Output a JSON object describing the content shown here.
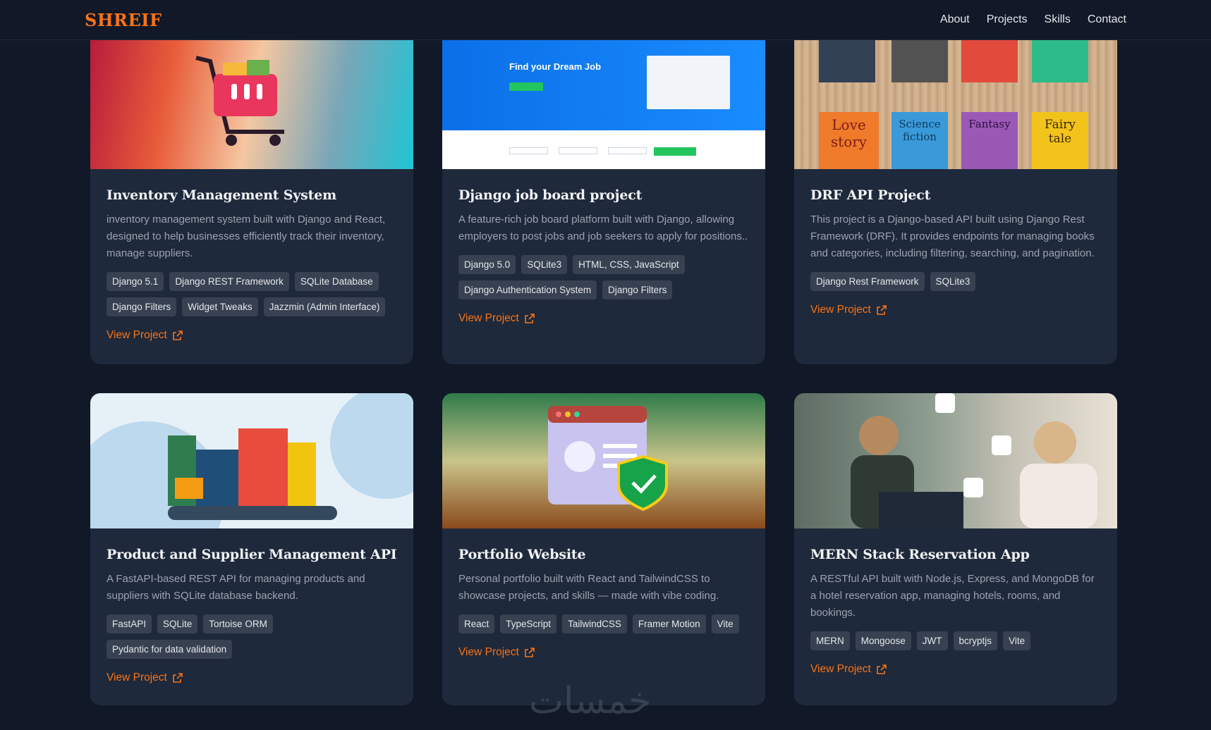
{
  "brand": {
    "logo": "SHREIF",
    "accent": "#f97316"
  },
  "nav": [
    {
      "label": "About"
    },
    {
      "label": "Projects"
    },
    {
      "label": "Skills"
    },
    {
      "label": "Contact"
    }
  ],
  "projects": [
    {
      "title": "Inventory Management System",
      "description": "inventory management system built with Django and React, designed to help businesses efficiently track their inventory, manage suppliers.",
      "tags": [
        "Django 5.1",
        "Django REST Framework",
        "SQLite Database",
        "Django Filters",
        "Widget Tweaks",
        "Jazzmin (Admin Interface)"
      ],
      "link": "View Project"
    },
    {
      "title": "Django job board project",
      "description": "A feature-rich job board platform built with Django, allowing employers to post jobs and job seekers to apply for positions..",
      "tags": [
        "Django 5.0",
        "SQLite3",
        "HTML, CSS, JavaScript",
        "Django Authentication System",
        "Django Filters"
      ],
      "link": "View Project",
      "thumb_heading": "Find your Dream Job"
    },
    {
      "title": "DRF API Project",
      "description": "This project is a Django-based API built using Django Rest Framework (DRF). It provides endpoints for managing books and categories, including filtering, searching, and pagination.",
      "tags": [
        "Django Rest Framework",
        "SQLite3"
      ],
      "link": "View Project",
      "thumb_books": [
        "Love story",
        "Science fiction",
        "Fantasy",
        "Fairy tale"
      ]
    },
    {
      "title": "Product and Supplier Management API",
      "description": "A FastAPI-based REST API for managing products and suppliers with SQLite database backend.",
      "tags": [
        "FastAPI",
        "SQLite",
        "Tortoise ORM",
        "Pydantic for data validation"
      ],
      "link": "View Project"
    },
    {
      "title": "Portfolio Website",
      "description": "Personal portfolio built with React and TailwindCSS to showcase projects, and skills — made with vibe coding.",
      "tags": [
        "React",
        "TypeScript",
        "TailwindCSS",
        "Framer Motion",
        "Vite"
      ],
      "link": "View Project"
    },
    {
      "title": "MERN Stack Reservation App",
      "description": "A RESTful API built with Node.js, Express, and MongoDB for a hotel reservation app, managing hotels, rooms, and bookings.",
      "tags": [
        "MERN",
        "Mongoose",
        "JWT",
        "bcryptjs",
        "Vite"
      ],
      "link": "View Project"
    }
  ],
  "watermark": "خمسات"
}
